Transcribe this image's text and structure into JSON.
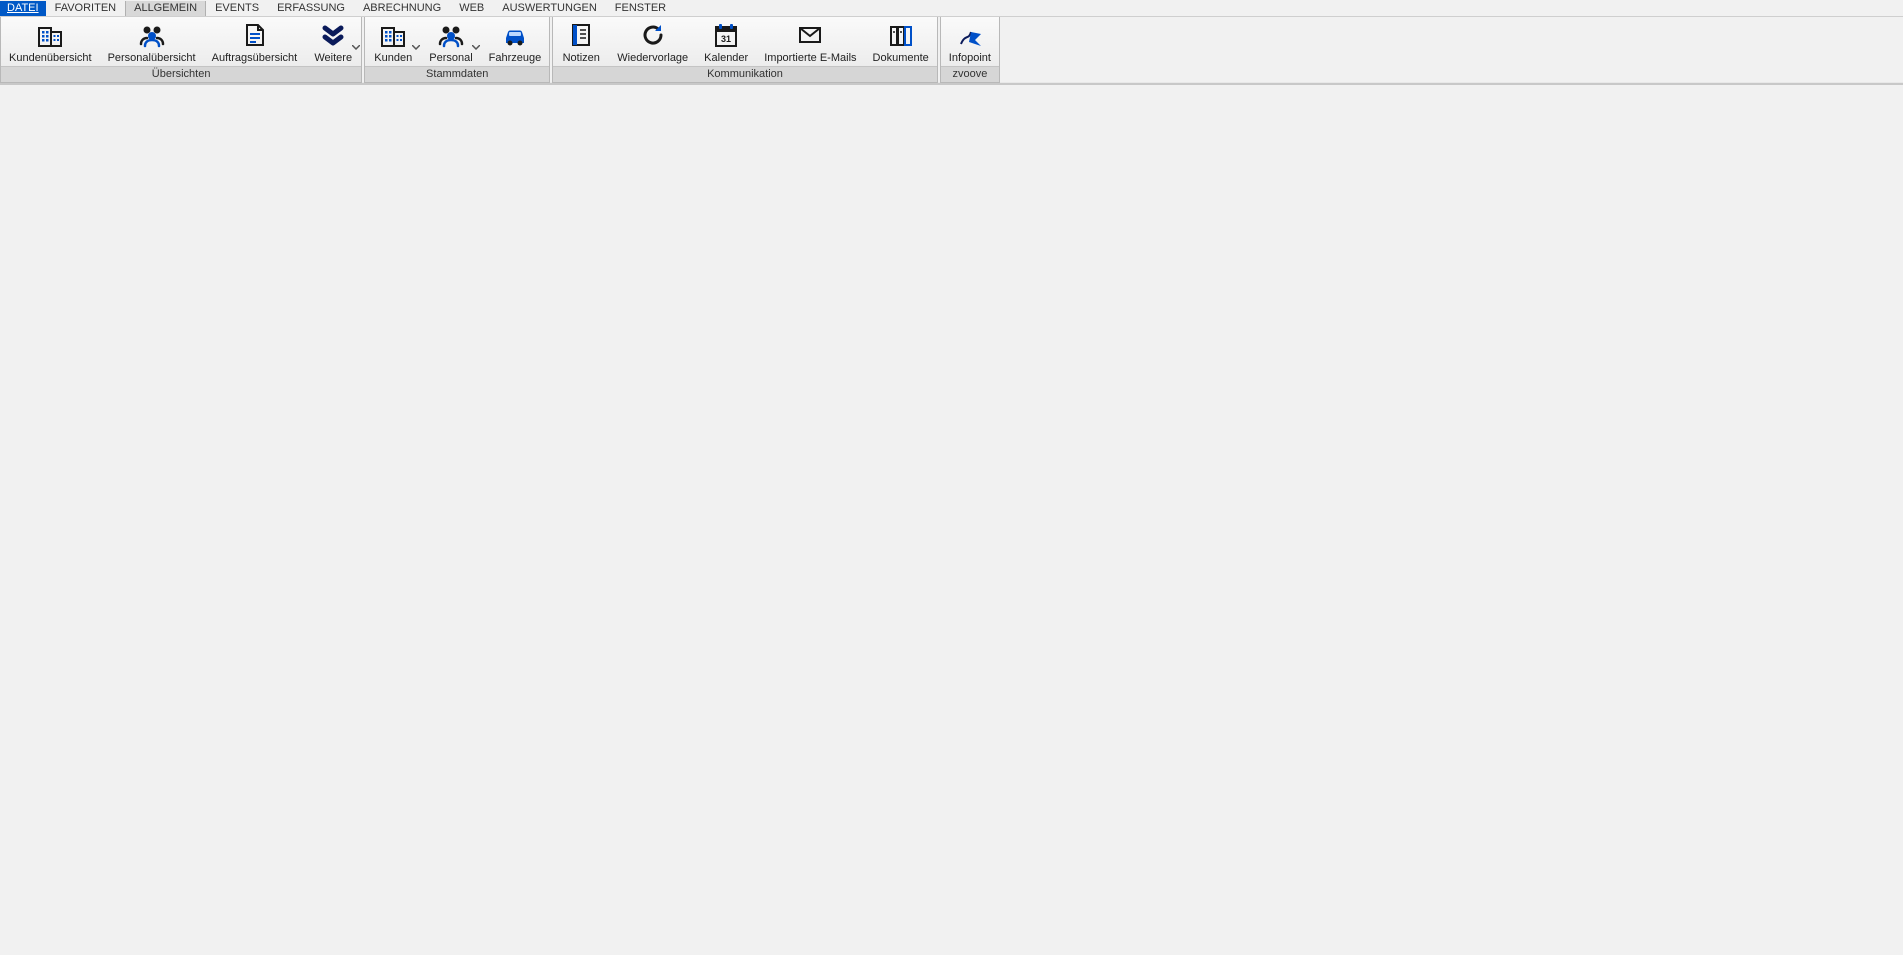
{
  "menu": {
    "items": [
      {
        "label": "DATEI",
        "type": "file"
      },
      {
        "label": "FAVORITEN"
      },
      {
        "label": "ALLGEMEIN",
        "active": true
      },
      {
        "label": "EVENTS"
      },
      {
        "label": "ERFASSUNG"
      },
      {
        "label": "ABRECHNUNG"
      },
      {
        "label": "WEB"
      },
      {
        "label": "AUSWERTUNGEN"
      },
      {
        "label": "FENSTER"
      }
    ]
  },
  "ribbon": {
    "groups": [
      {
        "title": "Übersichten",
        "buttons": [
          {
            "label": "Kundenübersicht",
            "icon": "buildings",
            "name": "kundenuebersicht-button"
          },
          {
            "label": "Personalübersicht",
            "icon": "people",
            "name": "personaluebersicht-button"
          },
          {
            "label": "Auftragsübersicht",
            "icon": "document",
            "name": "auftragsuebersicht-button"
          },
          {
            "label": "Weitere",
            "icon": "double-chevron-down",
            "dropdown": true,
            "name": "weitere-button"
          }
        ]
      },
      {
        "title": "Stammdaten",
        "buttons": [
          {
            "label": "Kunden",
            "icon": "buildings",
            "dropdown": true,
            "name": "kunden-button"
          },
          {
            "label": "Personal",
            "icon": "people",
            "dropdown": true,
            "name": "personal-button"
          },
          {
            "label": "Fahrzeuge",
            "icon": "car",
            "name": "fahrzeuge-button"
          }
        ]
      },
      {
        "title": "Kommunikation",
        "buttons": [
          {
            "label": "Notizen",
            "icon": "note",
            "name": "notizen-button"
          },
          {
            "label": "Wiedervorlage",
            "icon": "refresh",
            "name": "wiedervorlage-button"
          },
          {
            "label": "Kalender",
            "icon": "calendar",
            "calendar_day": "31",
            "name": "kalender-button"
          },
          {
            "label": "Importierte E-Mails",
            "icon": "mail",
            "name": "importierte-emails-button"
          },
          {
            "label": "Dokumente",
            "icon": "books",
            "name": "dokumente-button"
          }
        ]
      },
      {
        "title": "zvoove",
        "buttons": [
          {
            "label": "Infopoint",
            "icon": "flag",
            "name": "infopoint-button"
          }
        ]
      }
    ]
  }
}
